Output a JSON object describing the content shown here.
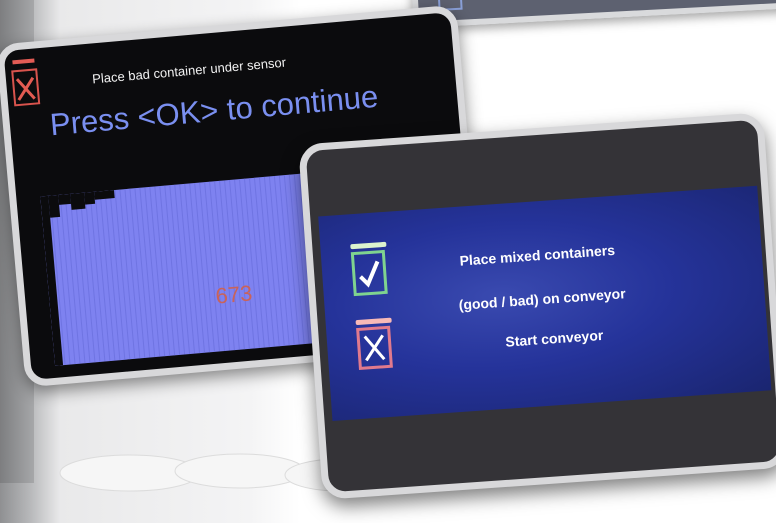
{
  "left_screen": {
    "message": "Place bad container under sensor",
    "prompt": "Press <OK> to continue",
    "count": "673",
    "icon": "x-mark-icon"
  },
  "right_screen": {
    "line1": "Place mixed containers",
    "line2": "(good / bad) on conveyor",
    "line3": "Start conveyor",
    "icons": [
      "check-container-icon",
      "x-container-icon"
    ]
  },
  "colors": {
    "accent_blue": "#7a8ff0",
    "plot_fill": "#7e82f0",
    "count_red": "#c9635a",
    "ok_green": "#7fd38f",
    "bad_pink": "#e07a8d",
    "panel_blue": "#25339a"
  }
}
